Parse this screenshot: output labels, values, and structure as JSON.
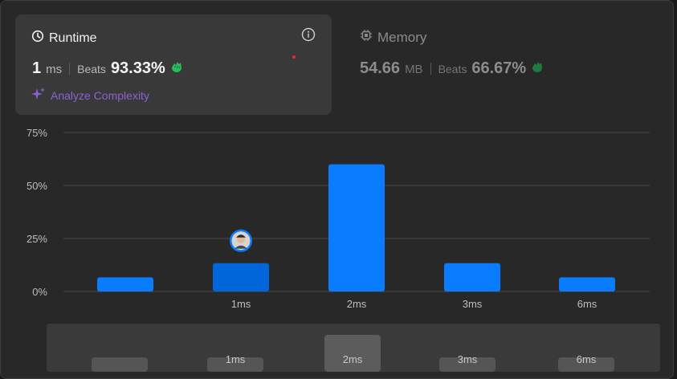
{
  "runtime": {
    "title": "Runtime",
    "value": "1",
    "unit": "ms",
    "beats_label": "Beats",
    "beats_value": "93.33%",
    "analyze_label": "Analyze Complexity"
  },
  "memory": {
    "title": "Memory",
    "value": "54.66",
    "unit": "MB",
    "beats_label": "Beats",
    "beats_value": "66.67%"
  },
  "colors": {
    "bar": "#0a7cff",
    "bar_selected": "#0066d9",
    "clap_green": "#2cbb5d",
    "analyze_purple": "#8a63d2"
  },
  "chart_data": {
    "type": "bar",
    "y_ticks": [
      "75%",
      "50%",
      "25%",
      "0%"
    ],
    "ylim": [
      0,
      75
    ],
    "categories": [
      "",
      "1ms",
      "2ms",
      "3ms",
      "6ms"
    ],
    "values": [
      6.67,
      13.33,
      60,
      13.33,
      6.67
    ],
    "highlight_index": 1
  },
  "range_selector": {
    "labels": [
      "",
      "1ms",
      "2ms",
      "3ms",
      "6ms"
    ],
    "active_index": 2
  }
}
